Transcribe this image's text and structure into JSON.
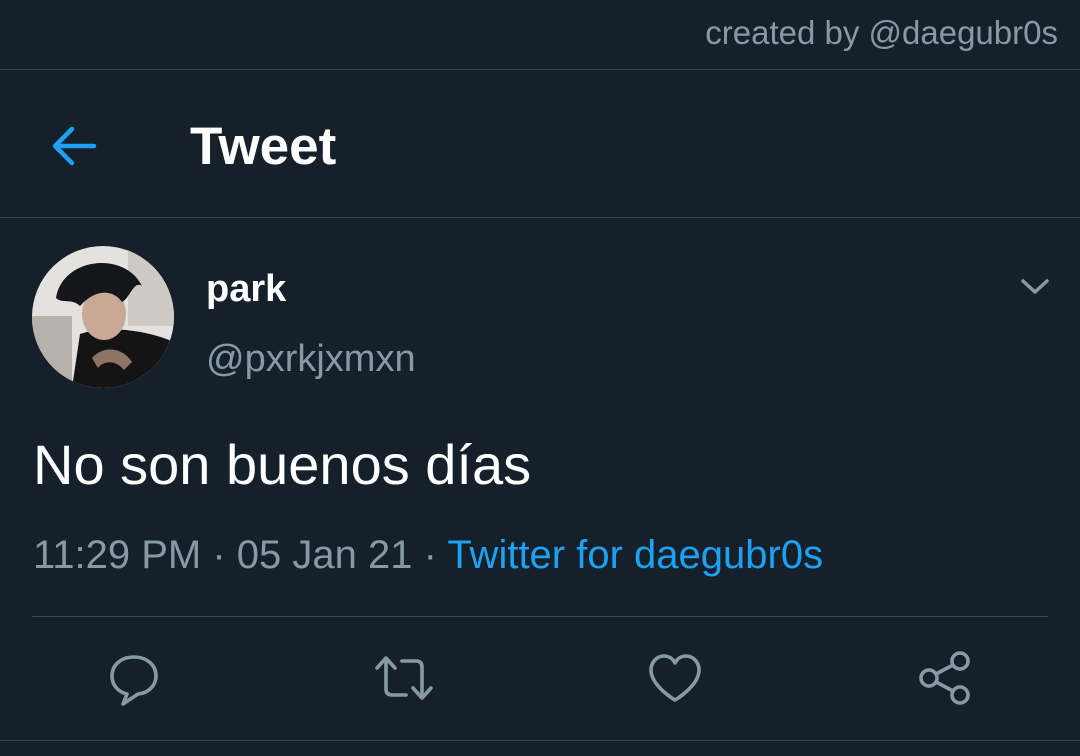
{
  "watermark": "created by @daegubr0s",
  "header": {
    "title": "Tweet",
    "back_icon": "arrow-left-icon"
  },
  "tweet": {
    "author": {
      "name": "park",
      "handle": "@pxrkjxmxn",
      "avatar": "avatar-photo"
    },
    "text": "No son buenos días",
    "time": "11:29 PM",
    "separator": " · ",
    "date": "05 Jan 21",
    "source": "Twitter for daegubr0s"
  },
  "actions": {
    "reply_icon": "reply-icon",
    "retweet_icon": "retweet-icon",
    "like_icon": "like-icon",
    "share_icon": "share-icon"
  },
  "colors": {
    "background": "#15202b",
    "text": "#ffffff",
    "muted": "#8899a6",
    "accent": "#1da1f2",
    "divider": "#38444d"
  }
}
